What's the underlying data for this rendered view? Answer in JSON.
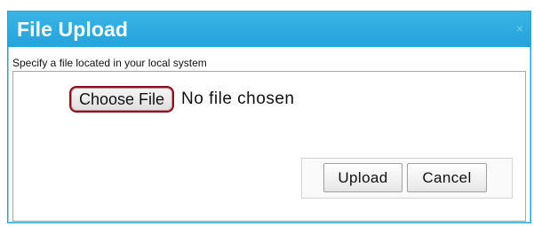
{
  "dialog": {
    "title": "File Upload",
    "close_glyph": "×",
    "instruction": "Specify a file located in your local system",
    "file_input": {
      "button_label": "Choose File",
      "status": "No file chosen"
    },
    "buttons": {
      "upload_label": "Upload",
      "cancel_label": "Cancel"
    }
  },
  "colors": {
    "titlebar": "#2aa7dd",
    "focus_outline": "#8a0f1e",
    "border": "#a9a9a9"
  },
  "icons": {
    "close": "close-icon"
  }
}
